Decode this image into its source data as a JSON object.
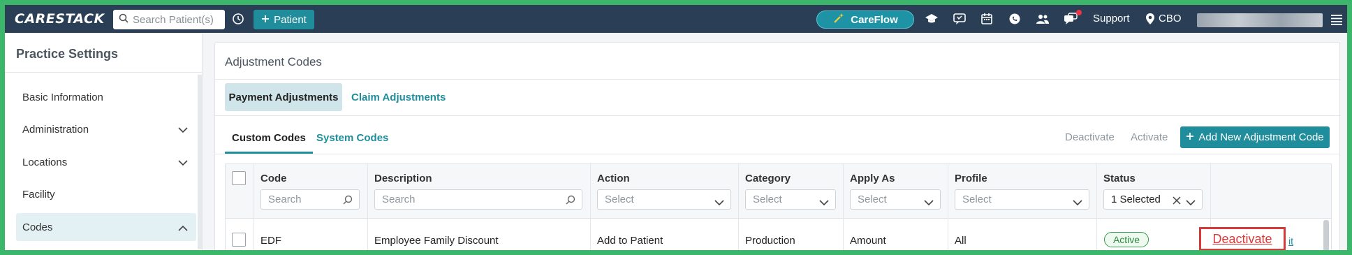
{
  "app": {
    "logo_text": "CARESTACK",
    "search_placeholder": "Search Patient(s)",
    "patient_button": "Patient",
    "careflow_button": "CareFlow",
    "support_label": "Support",
    "location_label": "CBO"
  },
  "sidebar": {
    "title": "Practice Settings",
    "items": [
      {
        "label": "Basic Information"
      },
      {
        "label": "Administration"
      },
      {
        "label": "Locations"
      },
      {
        "label": "Facility"
      },
      {
        "label": "Codes"
      }
    ]
  },
  "main": {
    "title": "Adjustment Codes",
    "tabs": [
      {
        "label": "Payment Adjustments"
      },
      {
        "label": "Claim Adjustments"
      }
    ],
    "subtabs": [
      {
        "label": "Custom Codes"
      },
      {
        "label": "System Codes"
      }
    ],
    "actions": {
      "deactivate": "Deactivate",
      "activate": "Activate",
      "add_new": "Add New Adjustment Code"
    }
  },
  "table": {
    "columns": [
      {
        "label": "Code",
        "filter": "Search"
      },
      {
        "label": "Description",
        "filter": "Search"
      },
      {
        "label": "Action",
        "filter": "Select"
      },
      {
        "label": "Category",
        "filter": "Select"
      },
      {
        "label": "Apply As",
        "filter": "Select"
      },
      {
        "label": "Profile",
        "filter": "Select"
      },
      {
        "label": "Status",
        "filter": "1 Selected"
      }
    ],
    "rows": [
      {
        "code": "EDF",
        "description": "Employee Family Discount",
        "action": "Add to Patient",
        "category": "Production",
        "apply_as": "Amount",
        "profile": "All",
        "status": "Active",
        "deactivate_link": "Deactivate",
        "edit_link_partial": "it"
      }
    ]
  },
  "colors": {
    "topbar": "#2a3f55",
    "accent": "#1f8d9b",
    "highlight_border": "#d63a3a",
    "frame": "#3cb66a"
  }
}
